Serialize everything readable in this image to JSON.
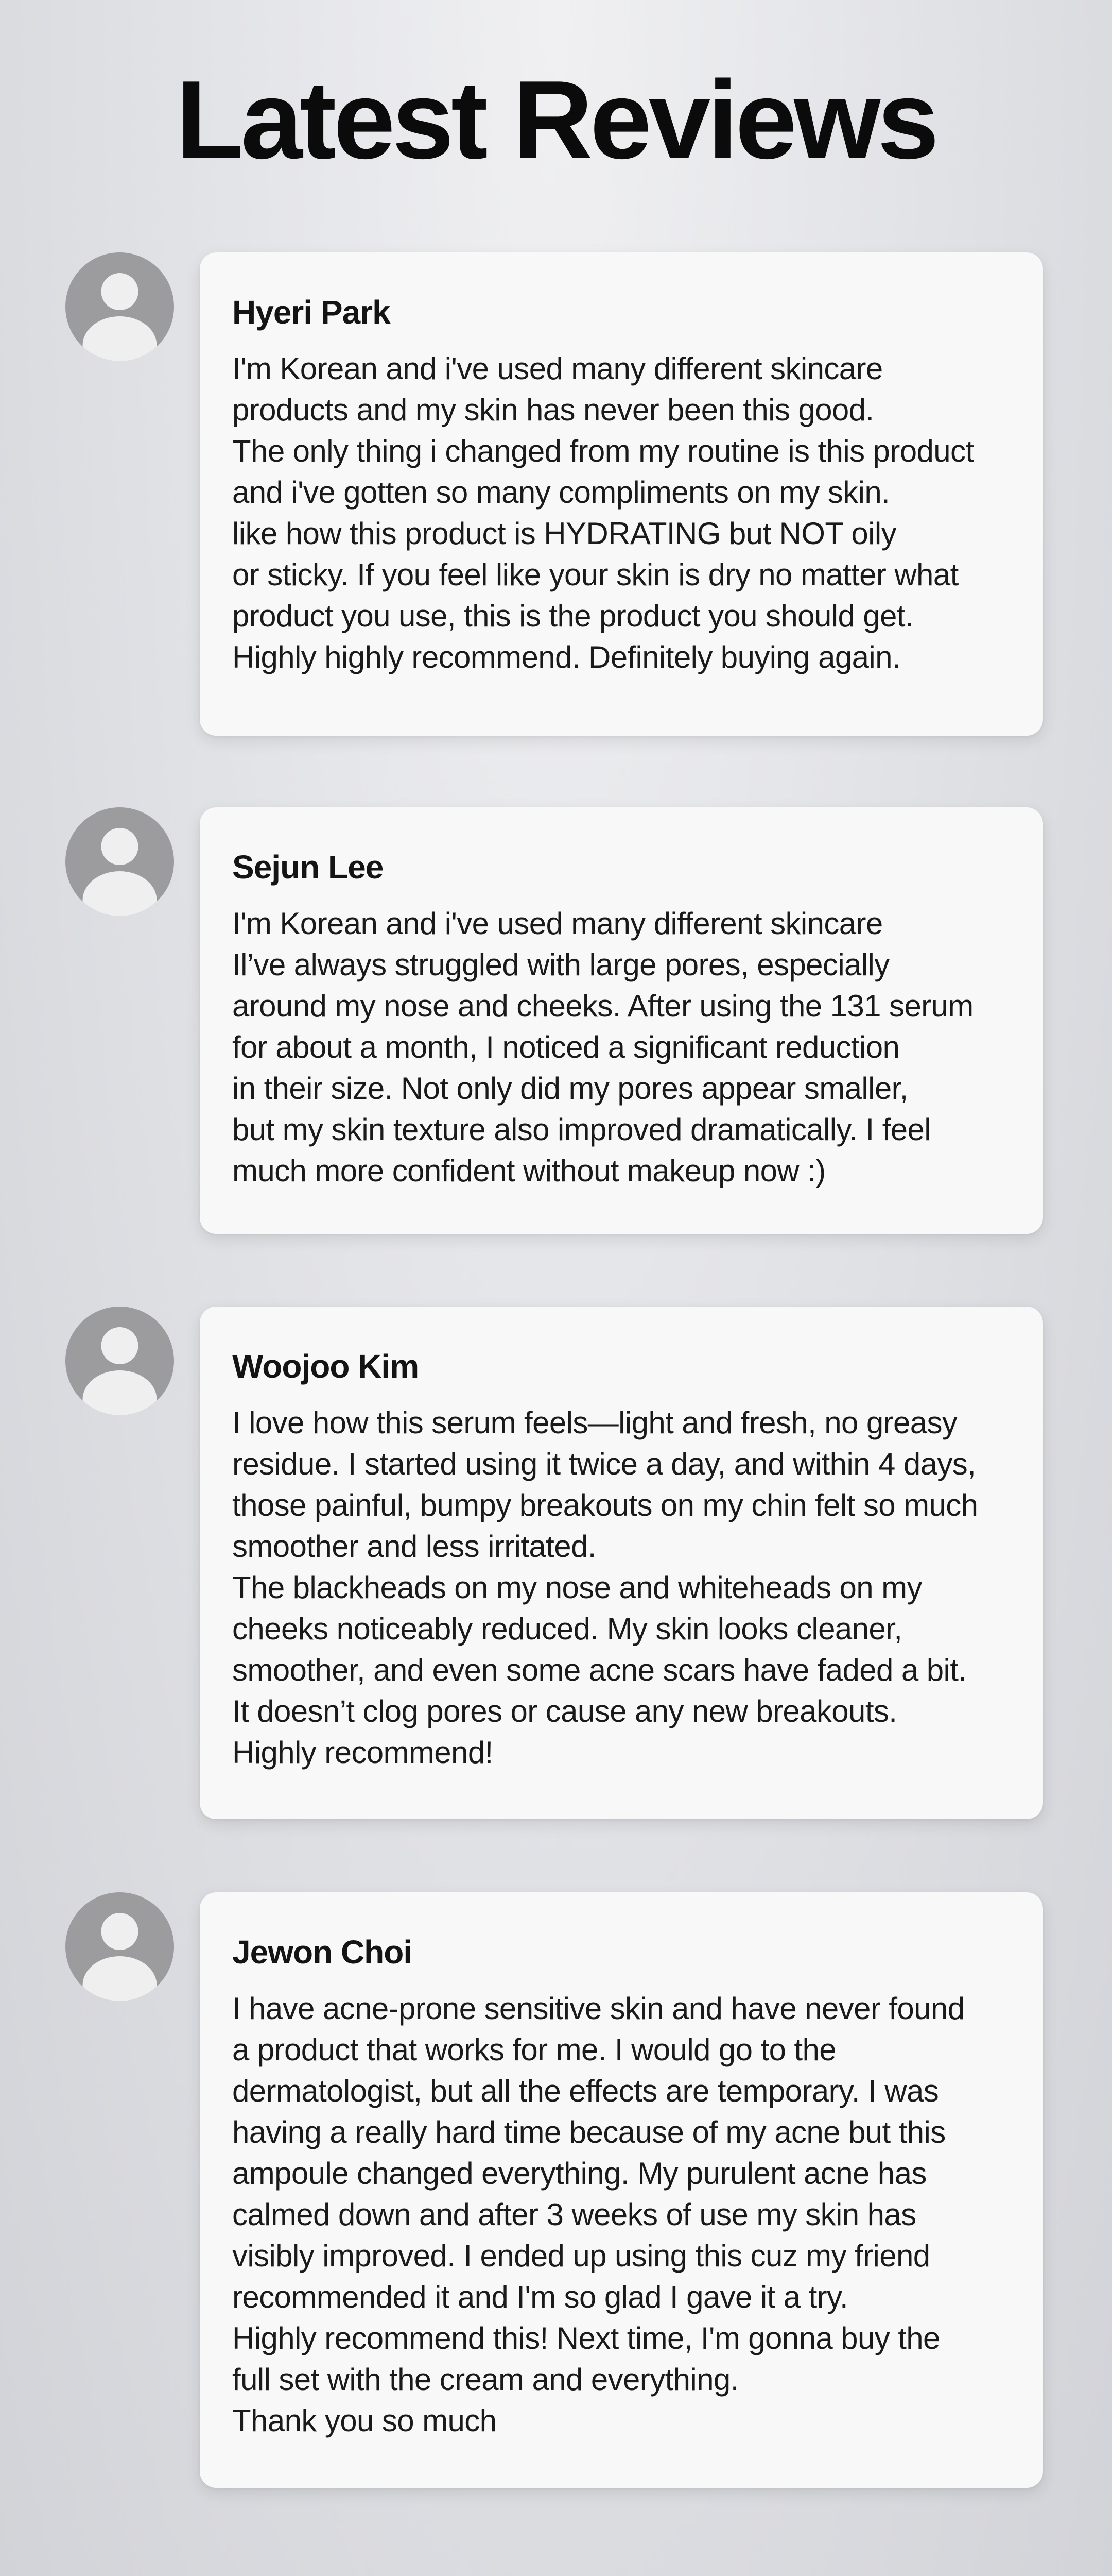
{
  "page_title": "Latest Reviews",
  "colors": {
    "card_background": "#f8f8f8",
    "avatar_background": "#9c9c9e",
    "avatar_figure": "#efefef"
  },
  "reviews": [
    {
      "name": "Hyeri Park",
      "avatar_icon": "user-silhouette-icon",
      "lines": [
        "I'm Korean and i've used many different skincare",
        "products and my skin has never been this good.",
        "The only thing i changed from my routine is this product",
        "and i've gotten so many compliments on my skin.",
        "like how this product is HYDRATING but NOT oily",
        "or sticky. If you feel like your skin is dry no matter what",
        "product you use, this is the product you should get.",
        "Highly highly recommend. Definitely buying again."
      ]
    },
    {
      "name": "Sejun Lee",
      "avatar_icon": "user-silhouette-icon",
      "lines": [
        "I'm Korean and i've used many different skincare",
        "Il’ve always struggled with large pores, especially",
        "around my nose and cheeks. After using the 131 serum",
        "for about a month, I noticed a significant reduction",
        "in their size. Not only did my pores appear smaller,",
        "but my skin texture also improved dramatically. I feel",
        "much more confident without makeup now :)"
      ]
    },
    {
      "name": "Woojoo Kim",
      "avatar_icon": "user-silhouette-icon",
      "lines": [
        "I love how this serum feels—light and fresh, no greasy",
        "residue. I started using it twice a day, and within 4 days,",
        "those painful, bumpy breakouts on my chin felt so much",
        "smoother and less irritated.",
        "The blackheads on my nose and whiteheads on my",
        "cheeks noticeably reduced. My skin looks cleaner,",
        "smoother, and even some acne scars have faded a bit.",
        "It doesn’t clog pores or cause any new breakouts.",
        "Highly recommend!"
      ]
    },
    {
      "name": "Jewon Choi",
      "avatar_icon": "user-silhouette-icon",
      "lines": [
        "I have acne-prone sensitive skin and have never found",
        "a product that works for me. I would go to the",
        "dermatologist, but all the effects are temporary. I was",
        "having a really hard time because of my acne but this",
        "ampoule changed everything. My purulent acne has",
        "calmed down and after 3 weeks of use my skin has",
        "visibly improved. I ended up using this cuz my friend",
        "recommended it and I'm so glad I gave it a try.",
        "Highly recommend this! Next time, I'm gonna buy the",
        "full set with the cream and everything.",
        "Thank you so much"
      ]
    }
  ]
}
